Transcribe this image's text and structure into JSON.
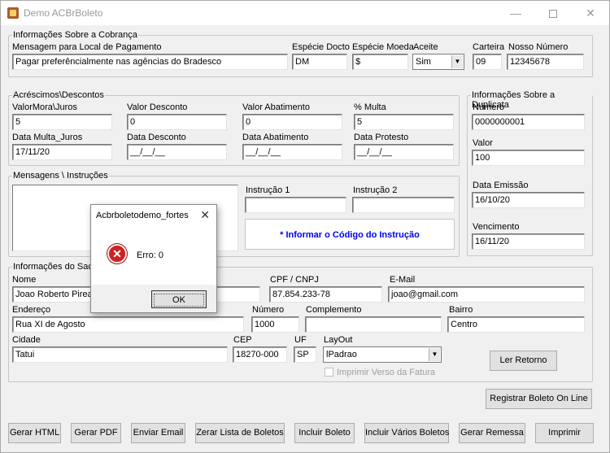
{
  "window": {
    "title": "Demo ACBrBoleto",
    "minimize": "—",
    "maximize": "",
    "close": "✕"
  },
  "cobranca": {
    "title": "Informações Sobre a Cobrança",
    "mensagem_label": "Mensagem para Local de Pagamento",
    "mensagem_value": "Pagar preferêncialmente nas agências do Bradesco",
    "especie_docto_label": "Espécie Docto",
    "especie_docto_value": "DM",
    "especie_moeda_label": "Espécie Moeda",
    "especie_moeda_value": "$",
    "aceite_label": "Aceite",
    "aceite_value": "Sim",
    "carteira_label": "Carteira",
    "carteira_value": "09",
    "nosso_numero_label": "Nosso Número",
    "nosso_numero_value": "12345678"
  },
  "acrescimos": {
    "title": "Acréscimos\\Descontos",
    "valor_mora_label": "ValorMora\\Juros",
    "valor_mora_value": "5",
    "valor_desconto_label": "Valor Desconto",
    "valor_desconto_value": "0",
    "valor_abatimento_label": "Valor Abatimento",
    "valor_abatimento_value": "0",
    "multa_label": "% Multa",
    "multa_value": "5",
    "data_multa_label": "Data Multa_Juros",
    "data_multa_value": "17/11/20",
    "data_desconto_label": "Data Desconto",
    "data_desconto_value": "__/__/__",
    "data_abatimento_label": "Data Abatimento",
    "data_abatimento_value": "__/__/__",
    "data_protesto_label": "Data Protesto",
    "data_protesto_value": "__/__/__"
  },
  "duplicata": {
    "title": "Informações Sobre a Duplicata",
    "numero_label": "Número",
    "numero_value": "0000000001",
    "valor_label": "Valor",
    "valor_value": "100",
    "data_emissao_label": "Data Emissão",
    "data_emissao_value": "16/10/20",
    "vencimento_label": "Vencimento",
    "vencimento_value": "16/11/20"
  },
  "mensagens": {
    "title": "Mensagens \\ Instruções",
    "instrucao1_label": "Instrução 1",
    "instrucao1_value": "",
    "instrucao2_label": "Instrução 2",
    "instrucao2_value": "",
    "info_text": "* Informar o Código do Instrução"
  },
  "sacado": {
    "title": "Informações do Sacado",
    "nome_label": "Nome",
    "nome_value": "Joao Roberto Pirea",
    "cpf_label": "CPF / CNPJ",
    "cpf_value": "87.854.233-78",
    "email_label": "E-Mail",
    "email_value": "joao@gmail.com",
    "endereco_label": "Endereço",
    "endereco_value": "Rua XI de Agosto",
    "numero_label": "Número",
    "numero_value": "1000",
    "complemento_label": "Complemento",
    "complemento_value": "",
    "bairro_label": "Bairro",
    "bairro_value": "Centro",
    "cidade_label": "Cidade",
    "cidade_value": "Tatui",
    "cep_label": "CEP",
    "cep_value": "18270-000",
    "uf_label": "UF",
    "uf_value": "SP",
    "layout_label": "LayOut",
    "layout_value": "lPadrao",
    "imprimir_verso_label": "Imprimir Verso da Fatura",
    "ler_retorno": "Ler Retorno"
  },
  "registrar_button": "Registrar Boleto On Line",
  "bottom_buttons": {
    "gerar_html": "Gerar HTML",
    "gerar_pdf": "Gerar PDF",
    "enviar_email": "Enviar Email",
    "zerar_lista": "Zerar Lista de Boletos",
    "incluir_boleto": "Incluir Boleto",
    "incluir_varios": "Incluir Vários Boletos",
    "gerar_remessa": "Gerar Remessa",
    "imprimir": "Imprimir"
  },
  "dialog": {
    "title": "Acbrboletodemo_fortes",
    "close": "✕",
    "message": "Erro: 0",
    "ok": "OK"
  },
  "icons": {
    "app": "app-boleto-icon",
    "error": "error-icon",
    "dropdown": "chevron-down-icon"
  }
}
